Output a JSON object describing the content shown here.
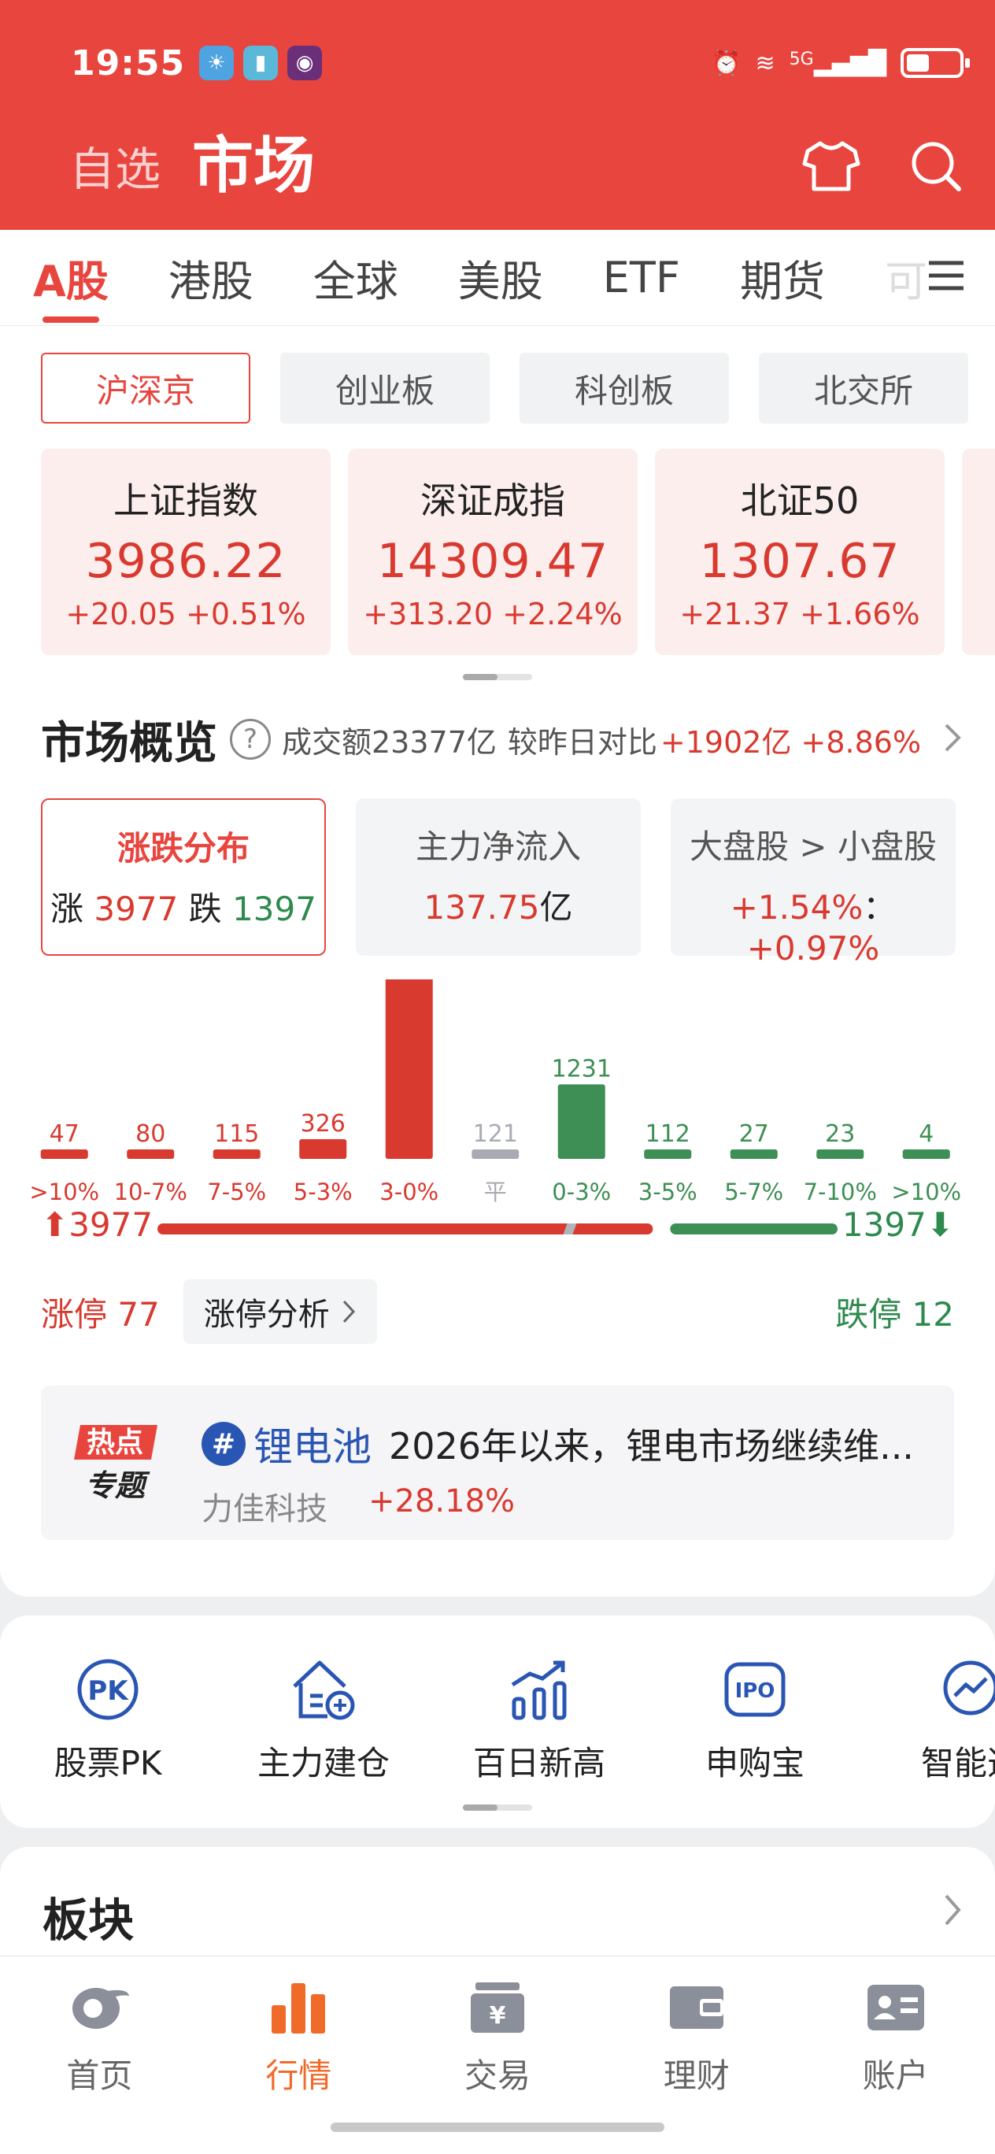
{
  "status_bar": {
    "time": "19:55",
    "network": "5G"
  },
  "header": {
    "inactive_title": "自选",
    "active_title": "市场"
  },
  "tabs": [
    "A股",
    "港股",
    "全球",
    "美股",
    "ETF",
    "期货",
    "可"
  ],
  "subtabs": [
    "沪深京",
    "创业板",
    "科创板",
    "北交所"
  ],
  "indices": [
    {
      "name": "上证指数",
      "value": "3986.22",
      "change": "+20.05 +0.51%"
    },
    {
      "name": "深证成指",
      "value": "14309.47",
      "change": "+313.20 +2.24%"
    },
    {
      "name": "北证50",
      "value": "1307.67",
      "change": "+21.37 +1.66%"
    }
  ],
  "overview": {
    "title": "市场概览",
    "help": "?",
    "turnover": "成交额23377亿",
    "compare_label": "较昨日对比",
    "compare_value": "+1902亿 +8.86%"
  },
  "stats": {
    "dist": {
      "title": "涨跌分布",
      "up_label": "涨",
      "up": "3977",
      "down_label": "跌",
      "down": "1397"
    },
    "flow": {
      "title": "主力净流入",
      "value": "137.75",
      "unit": "亿"
    },
    "cap": {
      "title": "大盘股 > 小盘股",
      "big": "+1.54%",
      "sep": "：",
      "small": "+0.97%"
    }
  },
  "chart_data": {
    "type": "bar",
    "categories": [
      ">10%",
      "10-7%",
      "7-5%",
      "5-3%",
      "3-0%",
      "平",
      "0-3%",
      "3-5%",
      "5-7%",
      "7-10%",
      ">10%"
    ],
    "values": [
      47,
      80,
      115,
      326,
      3409,
      121,
      1231,
      112,
      27,
      23,
      4
    ],
    "bar_colors": [
      "#d93a30",
      "#d93a30",
      "#d93a30",
      "#d93a30",
      "#d93a30",
      "#a9abb3",
      "#3e8f55",
      "#3e8f55",
      "#3e8f55",
      "#3e8f55",
      "#3e8f55"
    ],
    "up_total": "3977",
    "down_total": "1397",
    "up_share": 0.74
  },
  "limits": {
    "up": "涨停 77",
    "analysis": "涨停分析",
    "down": "跌停 12"
  },
  "hot": {
    "logo_top": "热点",
    "logo_bottom": "专题",
    "hash": "#",
    "topic": "锂电池",
    "desc": "2026年以来，锂电市场继续维...",
    "stock": "力佳科技",
    "pct": "+28.18%"
  },
  "tools": [
    {
      "label": "股票PK",
      "icon": "pk-icon"
    },
    {
      "label": "主力建仓",
      "icon": "house-plus-icon"
    },
    {
      "label": "百日新高",
      "icon": "bar-trend-icon"
    },
    {
      "label": "申购宝",
      "icon": "ipo-icon"
    },
    {
      "label": "智能选",
      "icon": "smart-pick-icon"
    }
  ],
  "sector": {
    "title": "板块"
  },
  "bottom_nav": [
    "首页",
    "行情",
    "交易",
    "理财",
    "账户"
  ],
  "colors": {
    "brand": "#e8453e",
    "up": "#d93a30",
    "down": "#2f8a4e",
    "nav_active": "#f06a2a"
  }
}
